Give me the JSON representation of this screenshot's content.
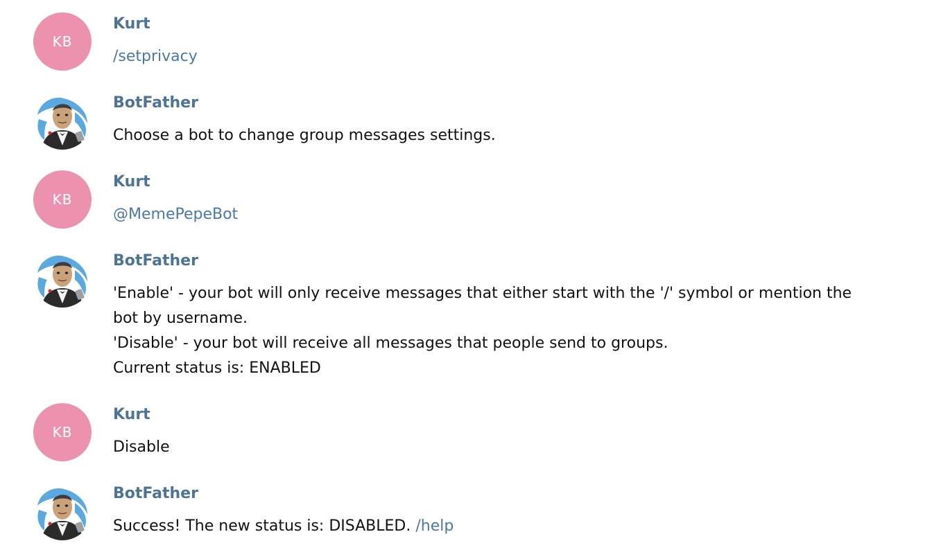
{
  "messages": [
    {
      "sender": "Kurt",
      "avatar_initials": "KB",
      "text": "/setprivacy"
    },
    {
      "sender": "BotFather",
      "avatar_icon": "botfather-avatar-icon",
      "text": "Choose a bot to change group messages settings."
    },
    {
      "sender": "Kurt",
      "avatar_initials": "KB",
      "text": "@MemePepeBot"
    },
    {
      "sender": "BotFather",
      "avatar_icon": "botfather-avatar-icon",
      "lines": [
        "'Enable' - your bot will only receive messages that either start with the '/' symbol or mention the",
        "bot by username.",
        "'Disable' - your bot will receive all messages that people send to groups.",
        "Current status is: ENABLED"
      ]
    },
    {
      "sender": "Kurt",
      "avatar_initials": "KB",
      "text": "Disable"
    },
    {
      "sender": "BotFather",
      "avatar_icon": "botfather-avatar-icon",
      "text": "Success! The new status is: DISABLED.",
      "link": "/help"
    }
  ],
  "colors": {
    "sender_name": "#4d7497",
    "link": "#4b78a6",
    "kurt_avatar": "#ec92ae",
    "text": "#111111"
  }
}
